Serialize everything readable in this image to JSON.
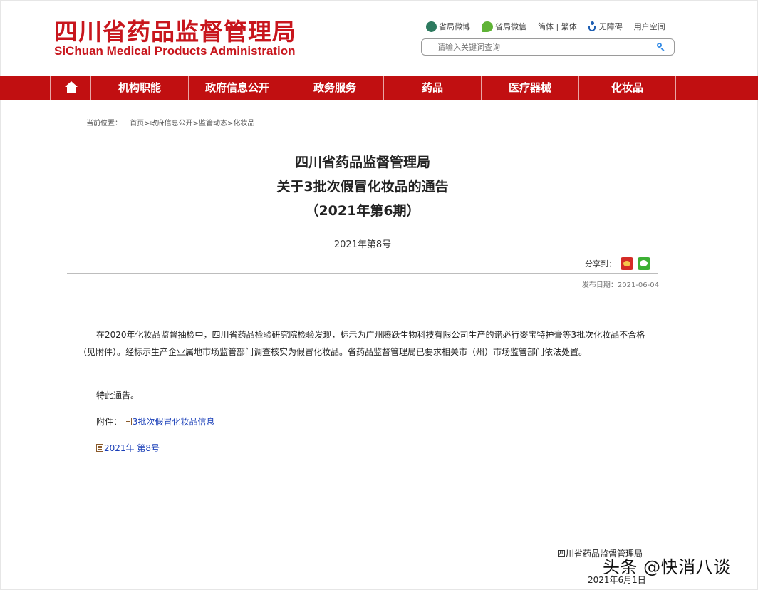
{
  "header": {
    "logo_cn": "四川省药品监督管理局",
    "logo_en": "SiChuan Medical Products Administration",
    "toplinks": {
      "weibo": "省局微博",
      "wechat": "省局微信",
      "script_toggle": "简体 | 繁体",
      "accessibility": "无障碍",
      "user_space": "用户空间"
    },
    "search_placeholder": "请输入关键词查询"
  },
  "nav": {
    "items": [
      "机构职能",
      "政府信息公开",
      "政务服务",
      "药品",
      "医疗器械",
      "化妆品"
    ]
  },
  "breadcrumb": {
    "label": "当前位置：",
    "path": "首页>政府信息公开>监管动态>化妆品"
  },
  "article": {
    "title_line1": "四川省药品监督管理局",
    "title_line2": "关于3批次假冒化妆品的通告",
    "title_line3": "（2021年第6期）",
    "doc_number": "2021年第8号",
    "share_label": "分享到：",
    "publish_date": "发布日期：2021-06-04",
    "paragraph": "在2020年化妆品监督抽检中，四川省药品检验研究院检验发现，标示为广州腾跃生物科技有限公司生产的诺必行婴宝特护膏等3批次化妆品不合格（见附件）。经标示生产企业属地市场监管部门调查核实为假冒化妆品。省药品监督管理局已要求相关市（州）市场监管部门依法处置。",
    "notice": "特此通告。",
    "attachment_label": "附件：",
    "attachment_link": "3批次假冒化妆品信息",
    "doc_link": "2021年 第8号",
    "signature_org": "四川省药品监督管理局",
    "signature_date": "2021年6月1日"
  },
  "watermark": "头条 @快消八谈"
}
